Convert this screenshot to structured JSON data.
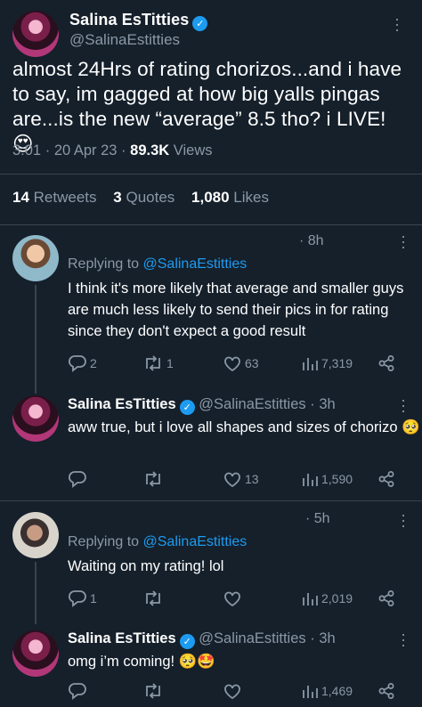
{
  "main_tweet": {
    "display_name": "Salina EsTitties",
    "handle": "@SalinaEstitties",
    "text": "almost 24Hrs of rating chorizos...and i have to say, im gagged at how big yalls pingas are...is the new “average” 8.5 tho? i LIVE! 😍",
    "time": "3:01",
    "date": "20 Apr 23",
    "views_count": "89.3K",
    "views_label": "Views",
    "retweets_count": "14",
    "retweets_label": "Retweets",
    "quotes_count": "3",
    "quotes_label": "Quotes",
    "likes_count": "1,080",
    "likes_label": "Likes"
  },
  "replies": [
    {
      "name": "",
      "handle": "",
      "time": "· 8h",
      "replying_prefix": "Replying to",
      "replying_to": "@SalinaEstitties",
      "text": "I think it's more likely that average and smaller guys are much less likely to send their pics in for rating since they don't expect a good result",
      "reply_count": "2",
      "retweet_count": "1",
      "like_count": "63",
      "view_count": "7,319"
    },
    {
      "name": "Salina EsTitties",
      "handle": "@SalinaEstitties",
      "time": "· 3h",
      "text": "aww true, but i love all shapes and sizes of chorizo 🥺",
      "reply_count": "",
      "retweet_count": "",
      "like_count": "13",
      "view_count": "1,590"
    },
    {
      "name": "",
      "handle": "",
      "time": "· 5h",
      "replying_prefix": "Replying to",
      "replying_to": "@SalinaEstitties",
      "text": "Waiting on my rating! lol",
      "reply_count": "1",
      "retweet_count": "",
      "like_count": "",
      "view_count": "2,019"
    },
    {
      "name": "Salina EsTitties",
      "handle": "@SalinaEstitties",
      "time": "· 3h",
      "text": "omg i’m coming! 🥺🤩",
      "reply_count": "",
      "retweet_count": "",
      "like_count": "",
      "view_count": "1,469"
    }
  ],
  "colors": {
    "background": "#15202b",
    "text": "#ffffff",
    "muted": "#8b98a5",
    "accent": "#1d9bf0",
    "divider": "#38444d"
  },
  "icons": [
    "verified-badge-icon",
    "more-icon",
    "reply-icon",
    "retweet-icon",
    "like-icon",
    "views-icon",
    "share-icon"
  ]
}
